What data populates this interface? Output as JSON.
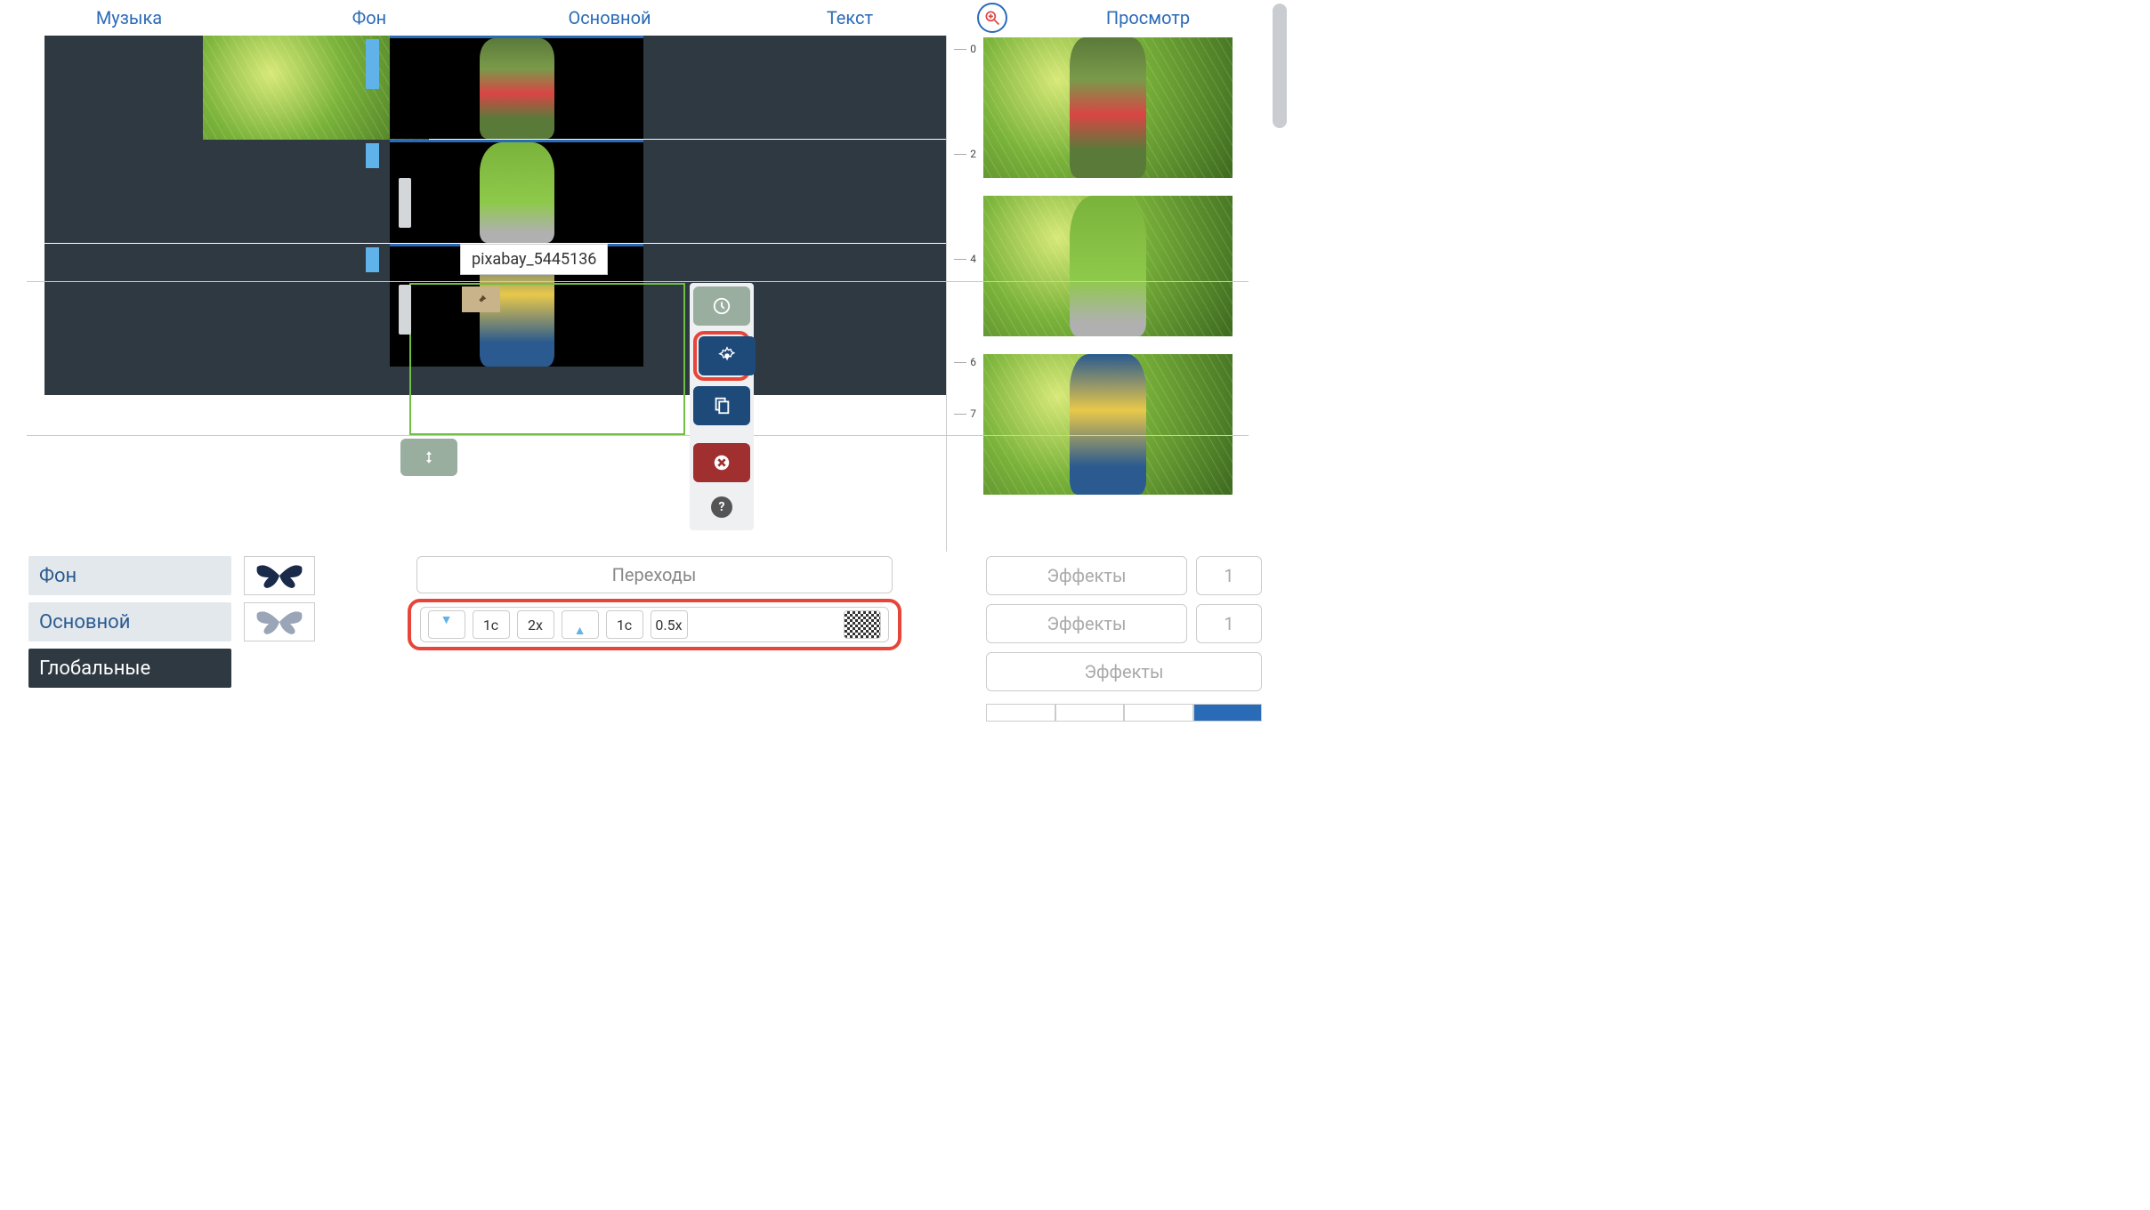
{
  "tabs": {
    "music": "Музыка",
    "background": "Фон",
    "main": "Основной",
    "text": "Текст",
    "preview": "Просмотр"
  },
  "tooltip": "pixabay_5445136",
  "ruler": {
    "t0": "0",
    "t1": "2",
    "t2": "4",
    "t3": "6",
    "t4": "7"
  },
  "layers": {
    "bg": "Фон",
    "main": "Основной",
    "global": "Глобальные"
  },
  "transitions": {
    "button": "Переходы",
    "v1": "1с",
    "v2": "2x",
    "v3": "1с",
    "v4": "0.5x"
  },
  "effects": {
    "label": "Эффекты",
    "n1": "1",
    "n2": "1"
  },
  "help": "?"
}
